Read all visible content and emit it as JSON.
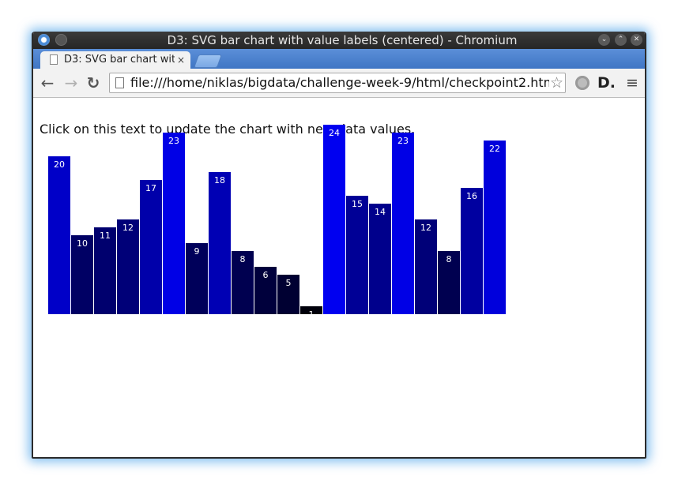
{
  "window": {
    "title": "D3: SVG bar chart with value labels (centered) - Chromium"
  },
  "tab": {
    "label": "D3: SVG bar chart wit",
    "close": "×"
  },
  "toolbar": {
    "url": "file:///home/niklas/bigdata/challenge-week-9/html/checkpoint2.html",
    "back_icon": "back-arrow-icon",
    "forward_icon": "forward-arrow-icon",
    "reload_icon": "reload-icon"
  },
  "page": {
    "intro_text": "Click on this text to update the chart with new data values."
  },
  "chart_data": {
    "type": "bar",
    "values": [
      20,
      10,
      11,
      12,
      17,
      23,
      9,
      18,
      8,
      6,
      5,
      1,
      24,
      15,
      14,
      23,
      12,
      8,
      16,
      22
    ],
    "value_labels_shown": true,
    "axes": "none",
    "color_scale": "value maps to blue intensity (rgb(0,0,value*10))",
    "bar_color_max": "#0000f0",
    "bar_color_min": "#00000a",
    "label_color": "#ffffff"
  }
}
